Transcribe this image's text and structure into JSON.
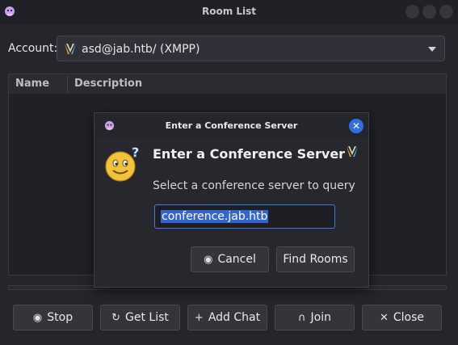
{
  "window": {
    "title": "Room List"
  },
  "account": {
    "label": "Account:",
    "value": "asd@jab.htb/ (XMPP)"
  },
  "list": {
    "columns": [
      "Name",
      "Description"
    ]
  },
  "buttons": {
    "stop": "Stop",
    "get_list": "Get List",
    "add_chat": "Add Chat",
    "join": "Join",
    "close": "Close"
  },
  "dialog": {
    "title": "Enter a Conference Server",
    "heading": "Enter a Conference Server",
    "subtitle": "Select a conference server to query",
    "input_value": "conference.jab.htb",
    "cancel": "Cancel",
    "find_rooms": "Find Rooms"
  },
  "icons": {
    "app": "pidgin-icon",
    "account": "xmpp-icon",
    "stop": "stop-icon",
    "get_list": "refresh-icon",
    "add_chat": "plus-icon",
    "join": "join-icon",
    "close": "close-icon",
    "dialog_close": "close-icon",
    "dialog_image": "thinking-smiley-icon"
  },
  "colors": {
    "accent": "#3465d0",
    "close_button": "#2f6fe0"
  }
}
